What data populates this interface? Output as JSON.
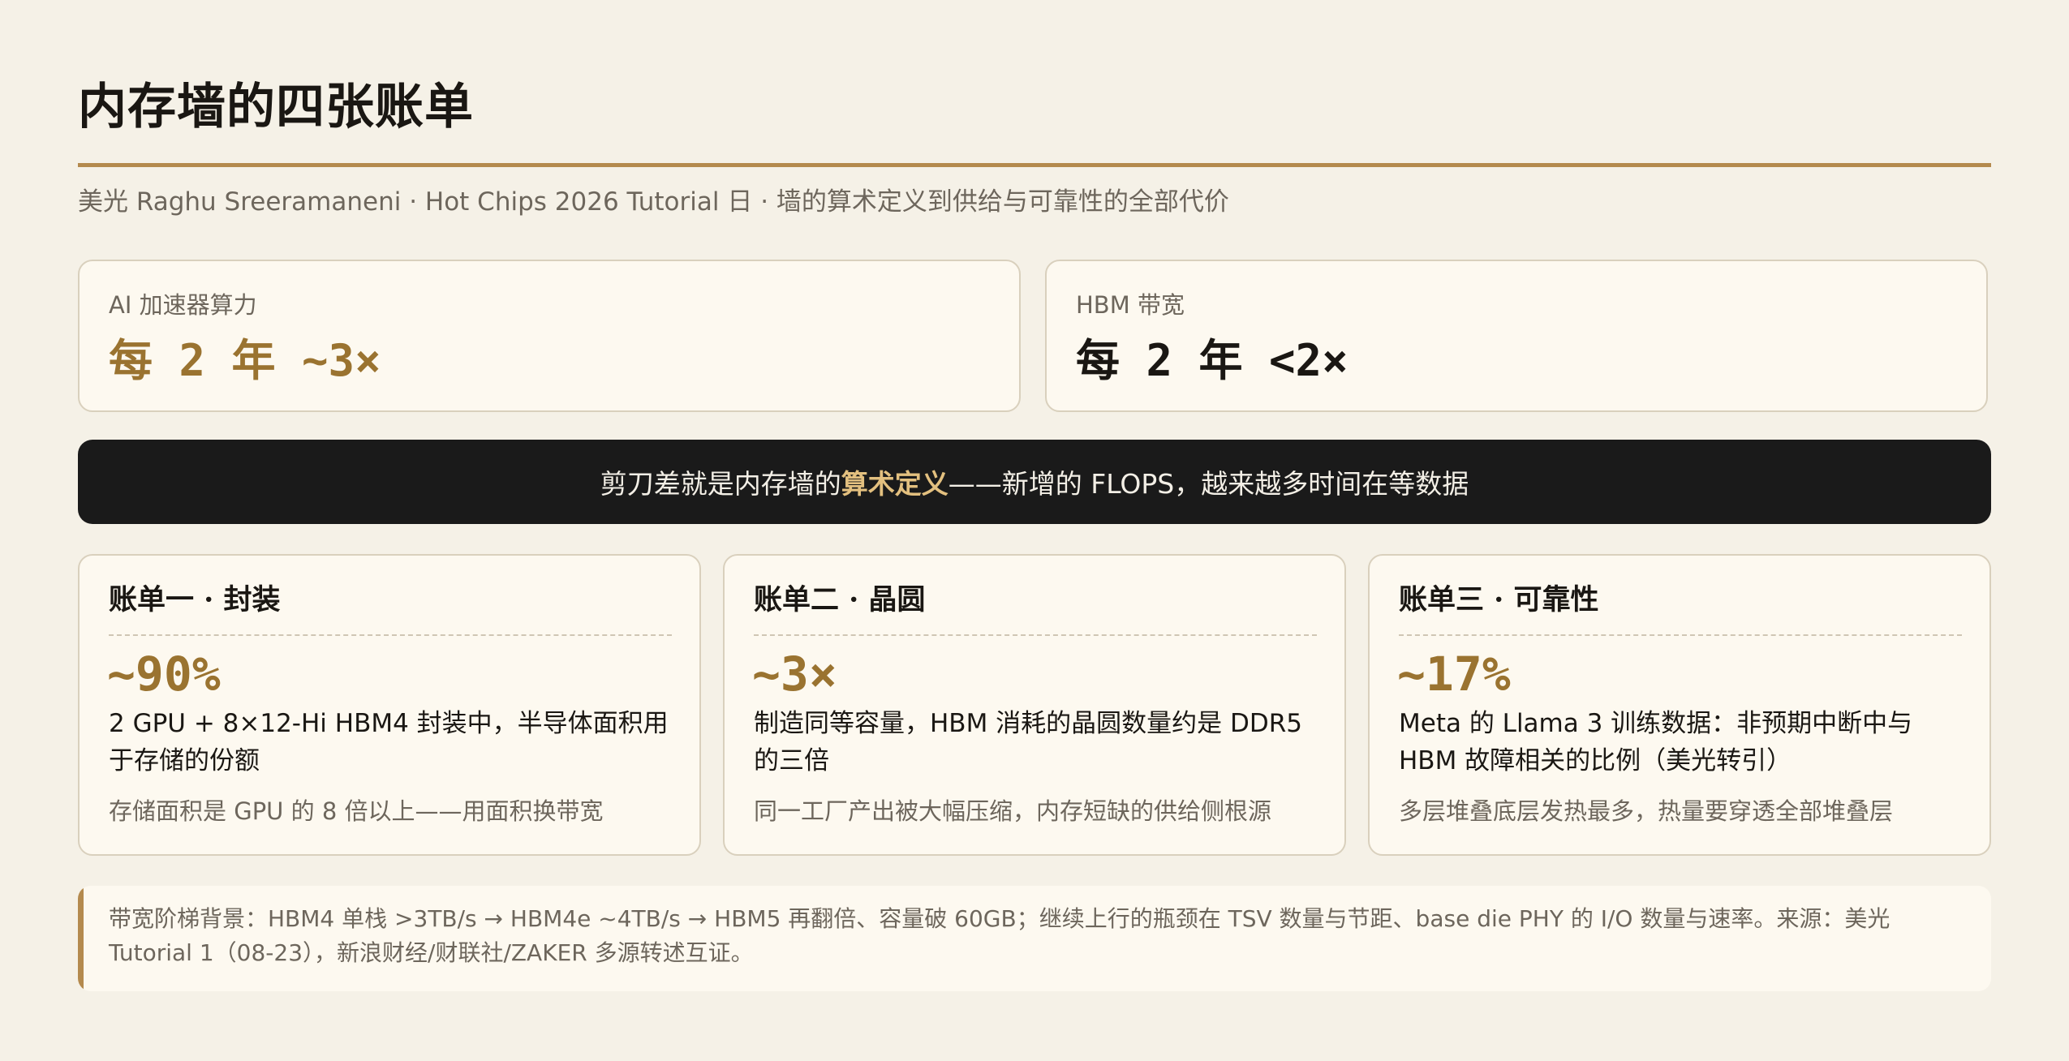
{
  "header": {
    "title": "内存墙的四张账单",
    "subtitle": "美光 Raghu Sreeramaneni · Hot Chips 2026 Tutorial 日 · 墙的算术定义到供给与可靠性的全部代价"
  },
  "stats": [
    {
      "label": "AI 加速器算力",
      "value": "每 2 年 ~3×"
    },
    {
      "label": "HBM 带宽",
      "value": "每 2 年 <2×"
    }
  ],
  "banner": {
    "before": "剪刀差就是内存墙的",
    "highlight": "算术定义",
    "after": "——新增的 FLOPS，越来越多时间在等数据"
  },
  "bills": [
    {
      "title": "账单一 · 封装",
      "number": "~90%",
      "desc": "2 GPU + 8×12-Hi HBM4 封装中，半导体面积用于存储的份额",
      "note": "存储面积是 GPU 的 8 倍以上——用面积换带宽"
    },
    {
      "title": "账单二 · 晶圆",
      "number": "~3×",
      "desc": "制造同等容量，HBM 消耗的晶圆数量约是 DDR5 的三倍",
      "note": "同一工厂产出被大幅压缩，内存短缺的供给侧根源"
    },
    {
      "title": "账单三 · 可靠性",
      "number": "~17%",
      "desc": "Meta 的 Llama 3 训练数据：非预期中断中与 HBM 故障相关的比例（美光转引）",
      "note": "多层堆叠底层发热最多，热量要穿透全部堆叠层"
    }
  ],
  "footnote": "带宽阶梯背景：HBM4 单栈 >3TB/s → HBM4e ~4TB/s → HBM5 再翻倍、容量破 60GB；继续上行的瓶颈在 TSV 数量与节距、base die PHY 的 I/O 数量与速率。来源：美光 Tutorial 1（08-23），新浪财经/财联社/ZAKER 多源转述互证。",
  "colors": {
    "accent": "#b48a4e",
    "accent_text": "#9a7330",
    "banner_bg": "#1a1a1a",
    "banner_highlight": "#e3c07f",
    "page_bg": "#f5f1e7"
  }
}
